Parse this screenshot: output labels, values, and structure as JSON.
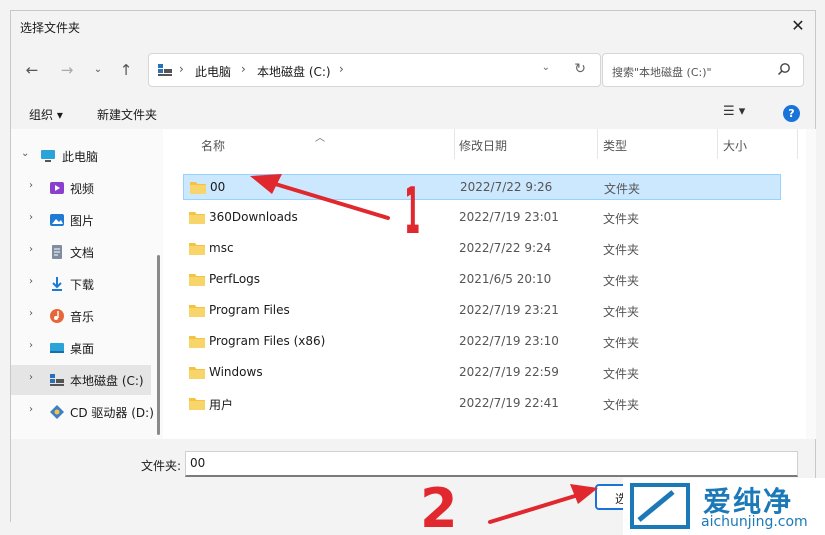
{
  "window": {
    "title": "选择文件夹"
  },
  "address": {
    "crumbs": [
      "此电脑",
      "本地磁盘 (C:)"
    ]
  },
  "search": {
    "placeholder": "搜索\"本地磁盘 (C:)\""
  },
  "commandbar": {
    "organize": "组织 ▾",
    "new_folder": "新建文件夹"
  },
  "sidebar": {
    "items": [
      {
        "label": "此电脑",
        "icon": "computer-icon"
      },
      {
        "label": "视频",
        "icon": "video-icon"
      },
      {
        "label": "图片",
        "icon": "picture-icon"
      },
      {
        "label": "文档",
        "icon": "document-icon"
      },
      {
        "label": "下载",
        "icon": "download-icon"
      },
      {
        "label": "音乐",
        "icon": "music-icon"
      },
      {
        "label": "桌面",
        "icon": "desktop-icon"
      },
      {
        "label": "本地磁盘 (C:)",
        "icon": "drive-icon"
      },
      {
        "label": "CD 驱动器 (D:)",
        "icon": "cd-drive-icon"
      }
    ]
  },
  "columns": {
    "name": "名称",
    "date": "修改日期",
    "type": "类型",
    "size": "大小"
  },
  "files": [
    {
      "name": "00",
      "date": "2022/7/22 9:26",
      "type": "文件夹"
    },
    {
      "name": "360Downloads",
      "date": "2022/7/19 23:01",
      "type": "文件夹"
    },
    {
      "name": "msc",
      "date": "2022/7/22 9:24",
      "type": "文件夹"
    },
    {
      "name": "PerfLogs",
      "date": "2021/6/5 20:10",
      "type": "文件夹"
    },
    {
      "name": "Program Files",
      "date": "2022/7/19 23:21",
      "type": "文件夹"
    },
    {
      "name": "Program Files (x86)",
      "date": "2022/7/19 23:10",
      "type": "文件夹"
    },
    {
      "name": "Windows",
      "date": "2022/7/19 22:59",
      "type": "文件夹"
    },
    {
      "name": "用户",
      "date": "2022/7/19 22:41",
      "type": "文件夹"
    }
  ],
  "bottom": {
    "folder_label": "文件夹:",
    "folder_value": "00",
    "select_label": "选"
  },
  "annotations": {
    "one": "1",
    "two": "2"
  },
  "watermark": {
    "cn": "爱纯净",
    "en": "aichunjing.com"
  },
  "colors": {
    "accent": "#1a73d9",
    "selection": "#cce8ff",
    "folder": "#f5c342",
    "arrow": "#e0282e"
  }
}
